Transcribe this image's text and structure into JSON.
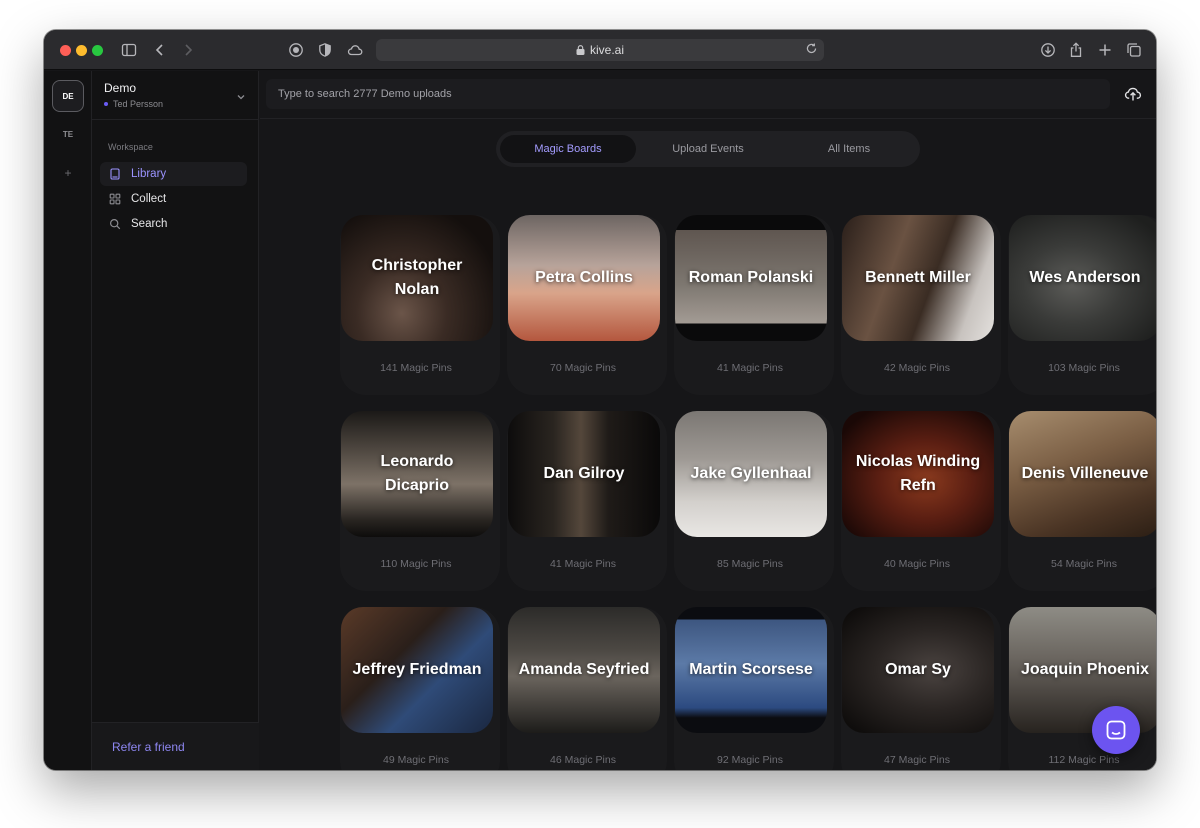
{
  "browser": {
    "url": "kive.ai"
  },
  "rail": {
    "active_label": "DE",
    "second_label": "TE",
    "add_label": "+"
  },
  "sidebar": {
    "workspace_name": "Demo",
    "user_name": "Ted Persson",
    "section_label": "Workspace",
    "items": [
      {
        "label": "Library",
        "icon": "book-icon"
      },
      {
        "label": "Collect",
        "icon": "grid-icon"
      },
      {
        "label": "Search",
        "icon": "search-icon"
      }
    ],
    "refer_label": "Refer a friend"
  },
  "search": {
    "placeholder": "Type to search 2777 Demo uploads"
  },
  "tabs": [
    "Magic Boards",
    "Upload Events",
    "All Items"
  ],
  "boards": [
    {
      "name": "Christopher Nolan",
      "pins": "141 Magic Pins"
    },
    {
      "name": "Petra Collins",
      "pins": "70 Magic Pins"
    },
    {
      "name": "Roman Polanski",
      "pins": "41 Magic Pins"
    },
    {
      "name": "Bennett Miller",
      "pins": "42 Magic Pins"
    },
    {
      "name": "Wes Anderson",
      "pins": "103 Magic Pins"
    },
    {
      "name": "Leonardo Dicaprio",
      "pins": "110 Magic Pins"
    },
    {
      "name": "Dan Gilroy",
      "pins": "41 Magic Pins"
    },
    {
      "name": "Jake Gyllenhaal",
      "pins": "85 Magic Pins"
    },
    {
      "name": "Nicolas Winding Refn",
      "pins": "40 Magic Pins"
    },
    {
      "name": "Denis Villeneuve",
      "pins": "54 Magic Pins"
    },
    {
      "name": "Jeffrey Friedman",
      "pins": "49 Magic Pins"
    },
    {
      "name": "Amanda Seyfried",
      "pins": "46 Magic Pins"
    },
    {
      "name": "Martin Scorsese",
      "pins": "92 Magic Pins"
    },
    {
      "name": "Omar Sy",
      "pins": "47 Magic Pins"
    },
    {
      "name": "Joaquin Phoenix",
      "pins": "112 Magic Pins"
    }
  ],
  "colors": {
    "accent": "#6c54f0",
    "active_text": "#a49cff",
    "background": "#161618"
  }
}
